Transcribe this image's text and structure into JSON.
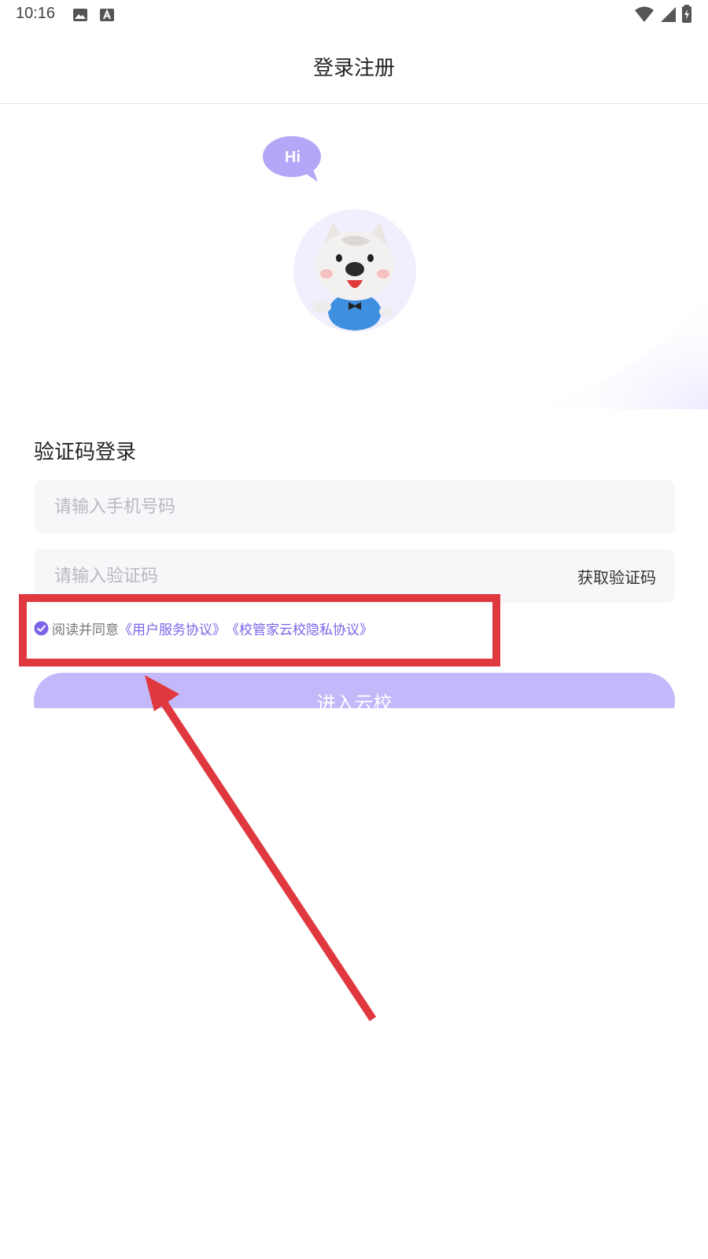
{
  "status_bar": {
    "time": "10:16",
    "left_icons": [
      "image-icon",
      "font-icon"
    ],
    "right_icons": [
      "wifi-icon",
      "signal-icon",
      "battery-icon"
    ]
  },
  "header": {
    "title": "登录注册"
  },
  "hero": {
    "bubble_text": "Hi",
    "mascot": "dog-mascot-avatar"
  },
  "form": {
    "heading": "验证码登录",
    "phone_placeholder": "请输入手机号码",
    "code_placeholder": "请输入验证码",
    "get_code_label": "获取验证码",
    "agreement": {
      "checked": true,
      "prefix": "阅读并同意",
      "service_link": "《用户服务协议》",
      "privacy_link": "《校管家云校隐私协议》"
    },
    "submit_label": "进入云校"
  },
  "colors": {
    "accent": "#7c63e8",
    "button_bg": "#c3b8fa",
    "annotation_red": "#e0383f",
    "field_bg": "#f6f7f9"
  }
}
